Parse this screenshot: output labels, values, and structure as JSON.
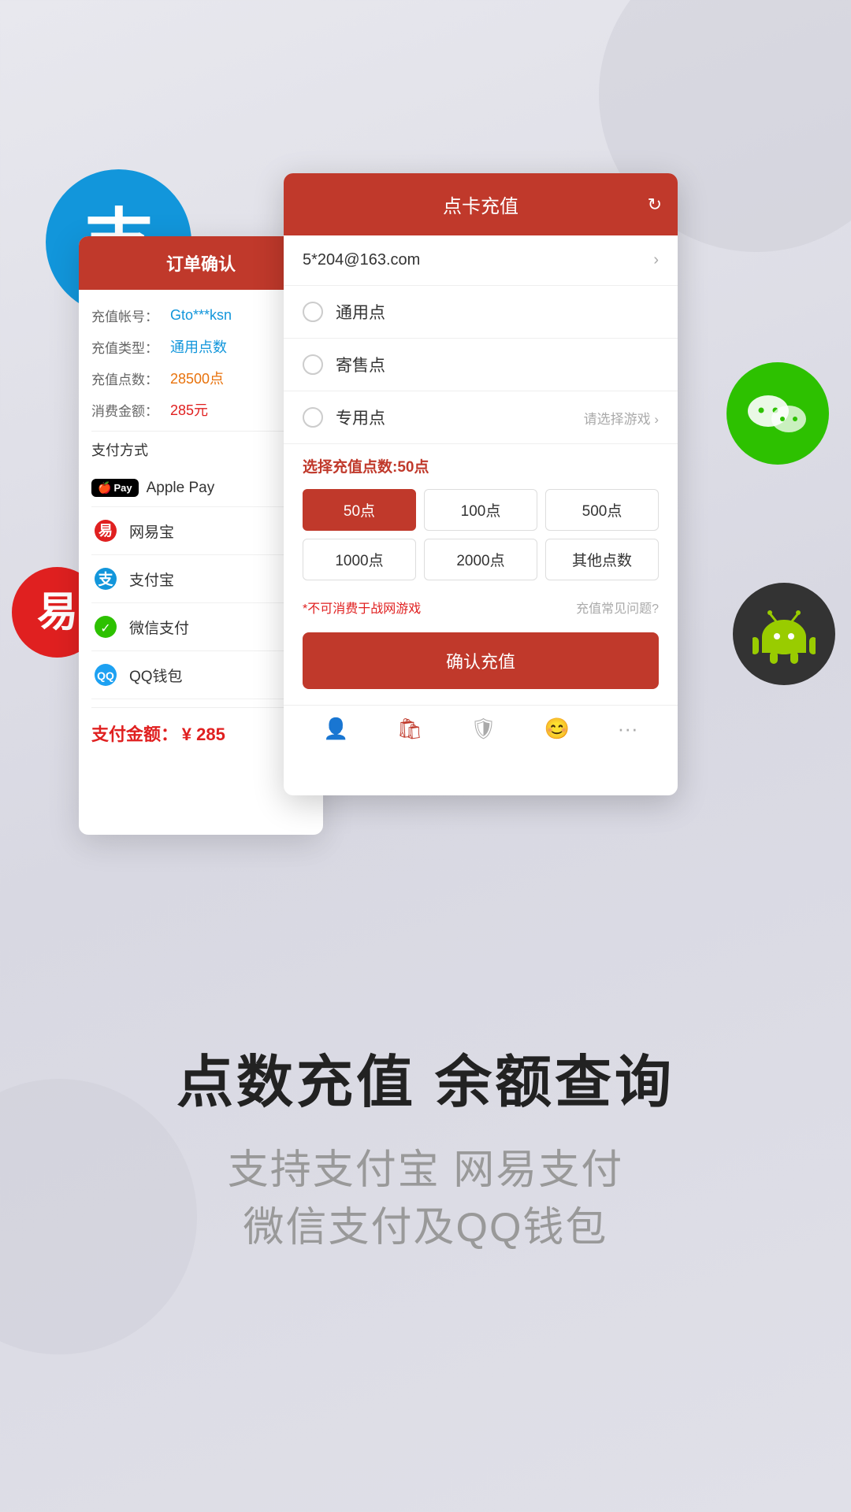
{
  "background": {
    "color": "#dcdce8"
  },
  "floating_icons": {
    "alipay": {
      "label": "支付宝",
      "bg": "#1296db",
      "symbol": "支"
    },
    "wechat": {
      "label": "微信",
      "bg": "#2dc100"
    },
    "netease": {
      "label": "网易",
      "bg": "#e02020"
    },
    "android": {
      "label": "Android",
      "bg": "#333"
    }
  },
  "card_left": {
    "header": "订单确认",
    "fields": [
      {
        "label": "充值帐号：",
        "value": "Gto***ksn",
        "color": "blue"
      },
      {
        "label": "充值类型：",
        "value": "通用点数",
        "color": "blue"
      },
      {
        "label": "充值点数：",
        "value": "28500点",
        "color": "orange"
      },
      {
        "label": "消费金额：",
        "value": "285元",
        "color": "red"
      }
    ],
    "payment_section_title": "支付方式",
    "payment_options": [
      {
        "name": "Apple Pay",
        "type": "applepay"
      },
      {
        "name": "网易宝",
        "type": "netease"
      },
      {
        "name": "支付宝",
        "type": "alipay"
      },
      {
        "name": "微信支付",
        "type": "wechat"
      },
      {
        "name": "QQ钱包",
        "type": "qq"
      }
    ],
    "payment_amount_label": "支付金额：",
    "payment_amount_value": "¥ 285"
  },
  "card_right": {
    "header_title": "点卡充值",
    "email": "5*204@163.com",
    "radio_options": [
      {
        "label": "通用点",
        "selected": false,
        "hint": ""
      },
      {
        "label": "寄售点",
        "selected": false,
        "hint": ""
      },
      {
        "label": "专用点",
        "selected": false,
        "hint": "请选择游戏"
      }
    ],
    "points_select_label": "选择充值点数:",
    "points_selected": "50点",
    "point_buttons": [
      {
        "label": "50点",
        "active": true
      },
      {
        "label": "100点",
        "active": false
      },
      {
        "label": "500点",
        "active": false
      },
      {
        "label": "1000点",
        "active": false
      },
      {
        "label": "2000点",
        "active": false
      },
      {
        "label": "其他点数",
        "active": false
      }
    ],
    "note": "*不可消费于战网游戏",
    "faq": "充值常见问题?",
    "confirm_button": "确认充值"
  },
  "bottom_nav": {
    "icons": [
      "person",
      "bag",
      "shield",
      "face",
      "dots"
    ]
  },
  "bottom_text": {
    "main_title": "点数充值 余额查询",
    "sub_line1": "支持支付宝  网易支付",
    "sub_line2": "微信支付及QQ钱包"
  }
}
